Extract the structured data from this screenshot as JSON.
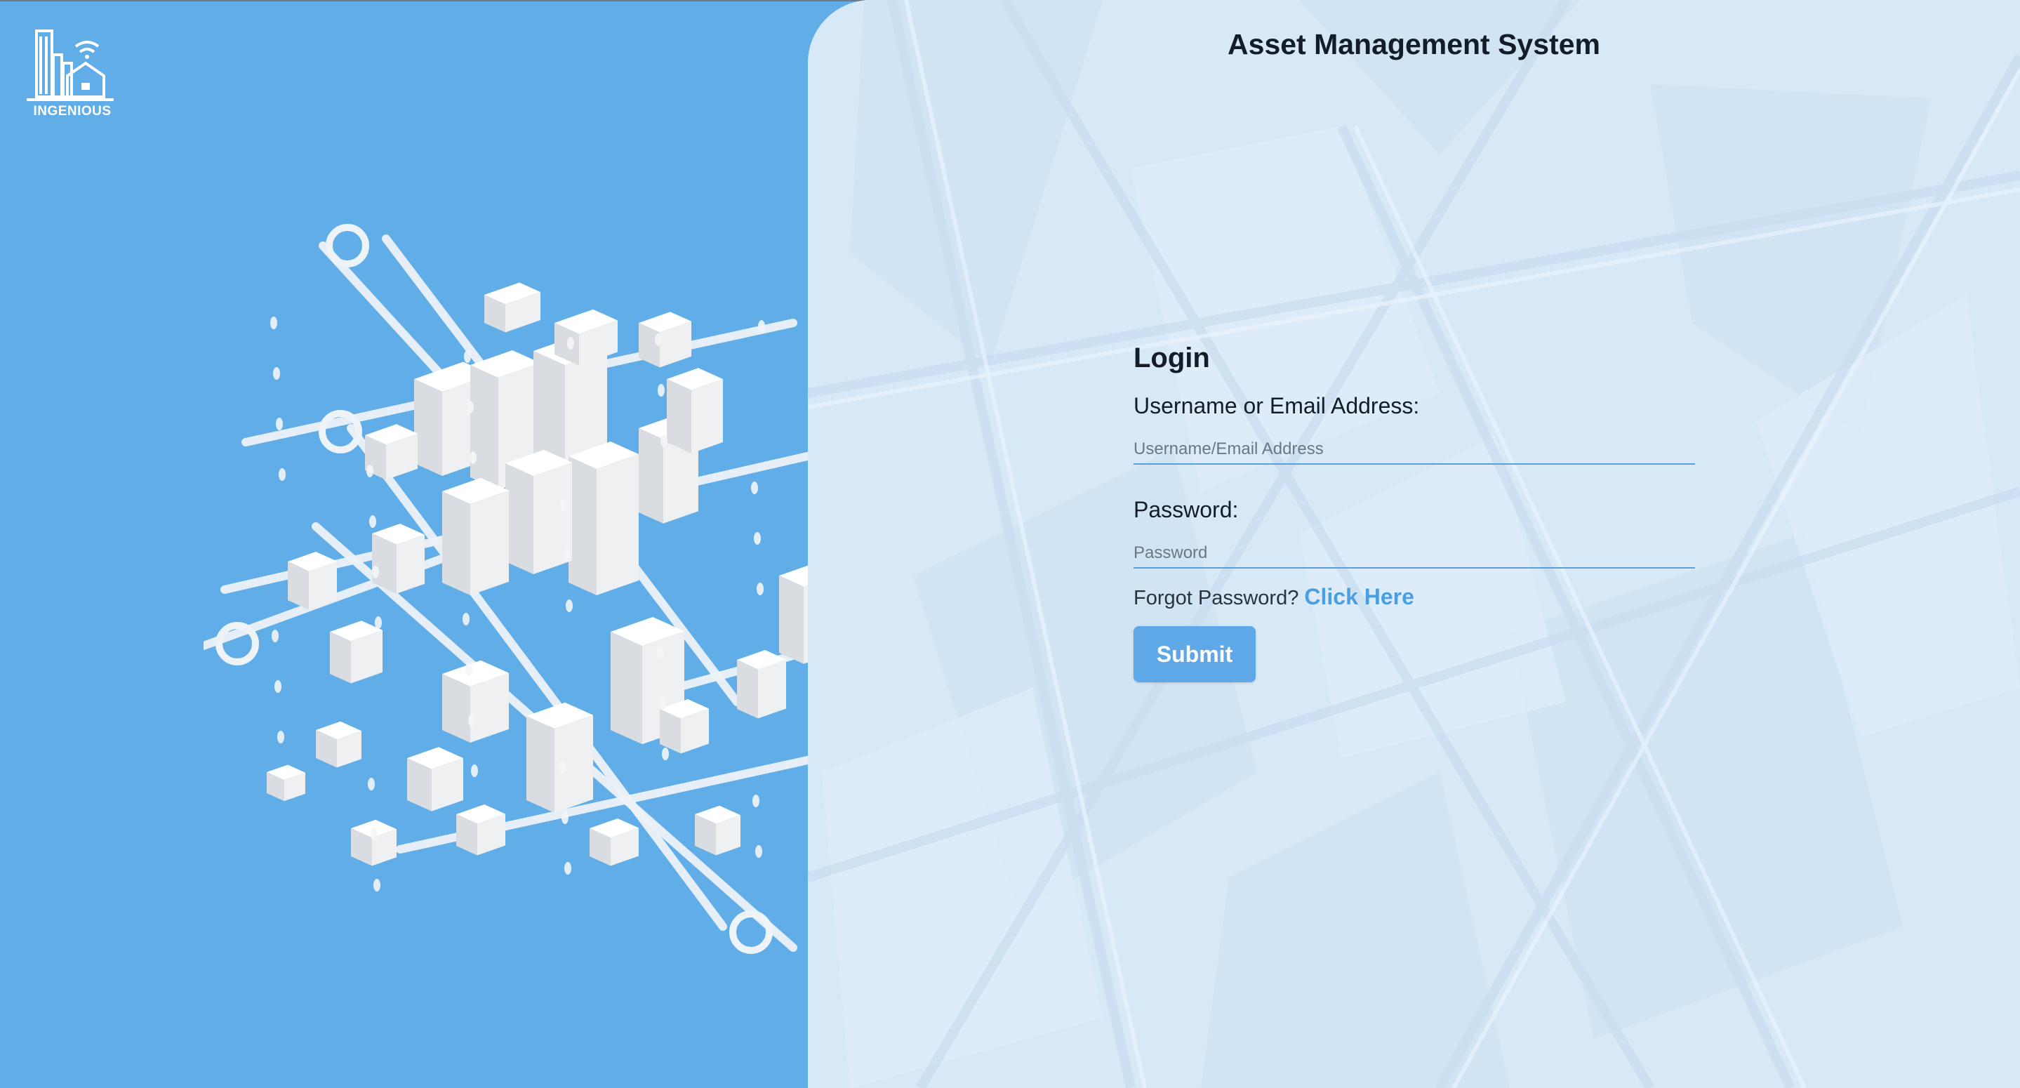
{
  "brand": {
    "logo_text": "INGENIOUS",
    "logo_icon": "building-wifi-icon",
    "left_panel_color": "#61ade8"
  },
  "header": {
    "title": "Asset Management System"
  },
  "login": {
    "heading": "Login",
    "username_label": "Username or Email Address:",
    "username_placeholder": "Username/Email Address",
    "username_value": "",
    "password_label": "Password:",
    "password_placeholder": "Password",
    "password_value": "",
    "forgot_text": "Forgot Password?",
    "forgot_link": "Click Here",
    "submit_label": "Submit"
  },
  "colors": {
    "accent": "#5ea8e8",
    "panel_bg": "#d7e9f7",
    "text": "#141d27"
  }
}
